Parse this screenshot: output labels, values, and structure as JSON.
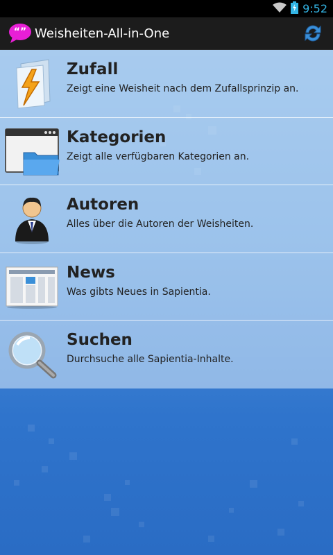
{
  "status_bar": {
    "time": "9:52",
    "wifi_icon": "wifi-icon",
    "battery_icon": "battery-charging-icon"
  },
  "action_bar": {
    "title": "Weisheiten-All-in-One",
    "app_icon": "quote-bubble-icon",
    "refresh_icon": "refresh-icon",
    "app_icon_color": "#e81fd6",
    "refresh_icon_color": "#3a8fd8"
  },
  "menu": {
    "items": [
      {
        "title": "Zufall",
        "description": "Zeigt eine Weisheit nach dem Zufallsprinzip an.",
        "icon": "lightning-folder-icon"
      },
      {
        "title": "Kategorien",
        "description": "Zeigt alle verfügbaren Kategorien an.",
        "icon": "window-folder-icon"
      },
      {
        "title": "Autoren",
        "description": "Alles über die Autoren der Weisheiten.",
        "icon": "businessman-icon"
      },
      {
        "title": "News",
        "description": "Was gibts Neues in Sapientia.",
        "icon": "newspaper-icon"
      },
      {
        "title": "Suchen",
        "description": "Durchsuche alle Sapientia-Inhalte.",
        "icon": "magnifier-icon"
      }
    ]
  },
  "colors": {
    "background_top": "#6fa7e0",
    "background_bottom": "#2a6cc4",
    "clock": "#33b5e5"
  }
}
